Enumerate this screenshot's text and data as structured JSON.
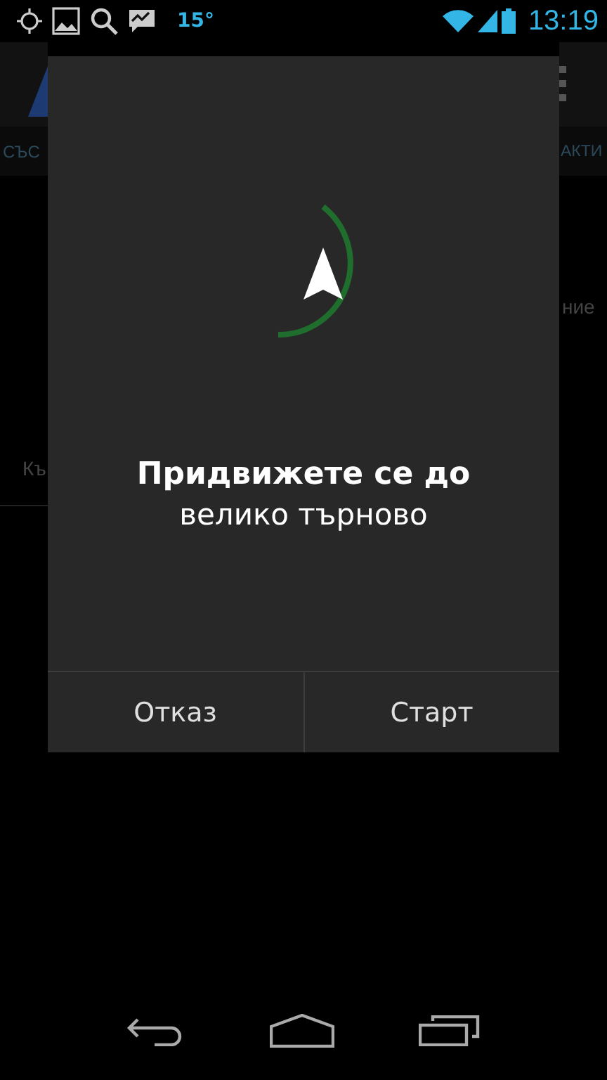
{
  "status_bar": {
    "temperature": "15°",
    "time": "13:19"
  },
  "background": {
    "tab_left": "СЪС",
    "tab_right": "АКТИ",
    "text_right": "ние",
    "text_left": "Къ"
  },
  "dialog": {
    "title": "Придвижете се до",
    "destination": "велико търново",
    "buttons": [
      "Отказ",
      "Старт"
    ]
  }
}
